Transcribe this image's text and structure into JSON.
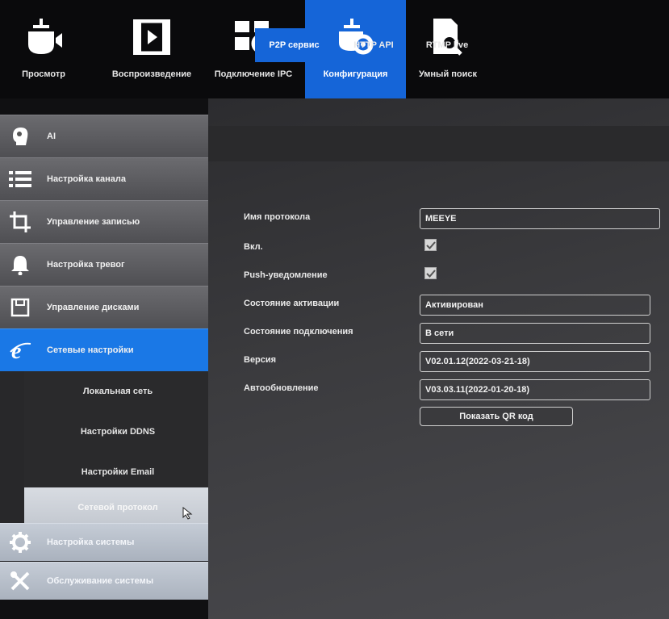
{
  "topnav": {
    "items": [
      {
        "label": "Просмотр",
        "icon": "live-view-icon"
      },
      {
        "label": "Воспроизведение",
        "icon": "playback-icon"
      },
      {
        "label": "Подключение IPC",
        "icon": "ipc-connect-icon"
      },
      {
        "label": "Конфигурация",
        "icon": "config-icon",
        "active": true
      },
      {
        "label": "Умный поиск",
        "icon": "smart-search-icon"
      }
    ]
  },
  "sidebar": {
    "items": [
      {
        "label": "AI",
        "icon": "ai-head-icon"
      },
      {
        "label": "Настройка канала",
        "icon": "channel-icon"
      },
      {
        "label": "Управление записью",
        "icon": "crop-record-icon"
      },
      {
        "label": "Настройка тревог",
        "icon": "bell-icon"
      },
      {
        "label": "Управление дисками",
        "icon": "disk-icon"
      },
      {
        "label": "Сетевые настройки",
        "icon": "network-ie-icon",
        "active": true
      },
      {
        "label": "Настройка системы",
        "icon": "gear-icon"
      },
      {
        "label": "Обслуживание системы",
        "icon": "tools-icon"
      }
    ],
    "subitems": [
      {
        "label": "Локальная сеть"
      },
      {
        "label": "Настройки DDNS"
      },
      {
        "label": "Настройки Email"
      },
      {
        "label": "Сетевой протокол",
        "selected": true
      }
    ]
  },
  "tabs": [
    {
      "label": "P2P сервис",
      "active": true
    },
    {
      "label": "HTTP API"
    },
    {
      "label": "RTMP live"
    }
  ],
  "form": {
    "protocol_name": {
      "label": "Имя протокола",
      "value": "MEEYE"
    },
    "enabled": {
      "label": "Вкл.",
      "checked": true
    },
    "push": {
      "label": "Push-уведомление",
      "checked": true
    },
    "activation_state": {
      "label": "Состояние активации",
      "value": "Активирован"
    },
    "connection_state": {
      "label": "Состояние подключения",
      "value": "В сети"
    },
    "version": {
      "label": "Версия",
      "value": "V02.01.12(2022-03-21-18)"
    },
    "auto_update": {
      "label": "Автообновление",
      "value": "V03.03.11(2022-01-20-18)"
    },
    "qr_button": "Показать QR код"
  },
  "colors": {
    "accent": "#1565d8",
    "sidebar_active": "#1a78e6"
  }
}
